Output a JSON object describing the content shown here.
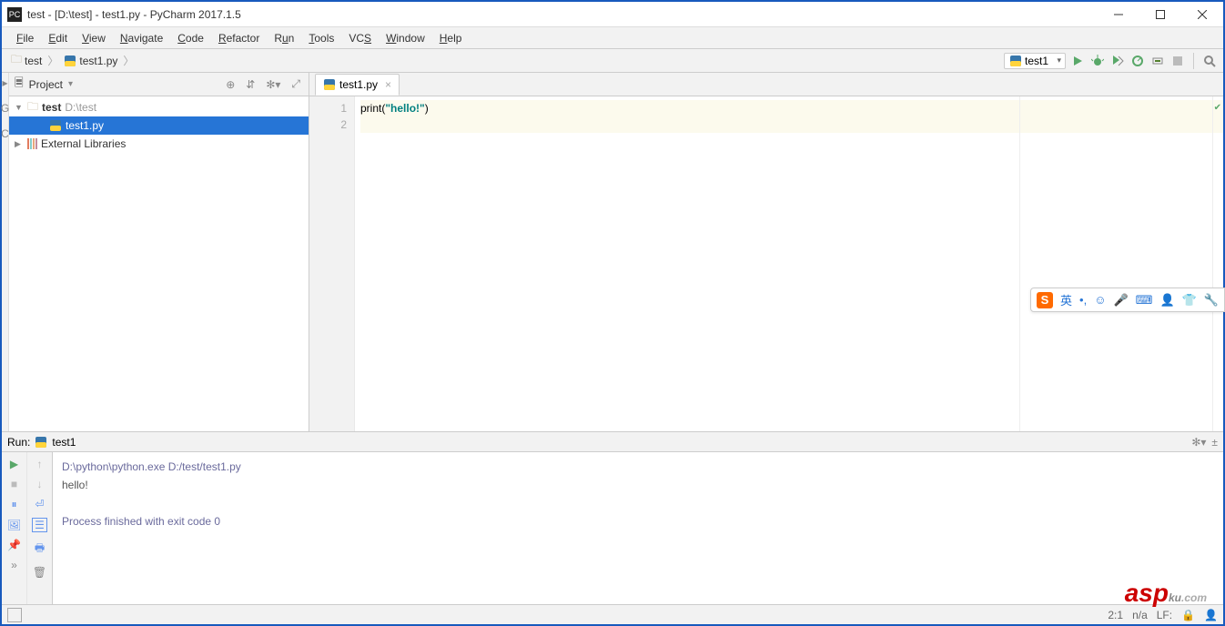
{
  "titlebar": {
    "app_icon_text": "PC",
    "title": "test - [D:\\test] - test1.py - PyCharm 2017.1.5"
  },
  "menu": {
    "items": [
      "File",
      "Edit",
      "View",
      "Navigate",
      "Code",
      "Refactor",
      "Run",
      "Tools",
      "VCS",
      "Window",
      "Help"
    ]
  },
  "breadcrumb": {
    "items": [
      "test",
      "test1.py"
    ]
  },
  "run_config": {
    "name": "test1"
  },
  "project": {
    "title": "Project",
    "root": {
      "name": "test",
      "path": "D:\\test"
    },
    "file": "test1.py",
    "ext_libs": "External Libraries"
  },
  "editor": {
    "tab": "test1.py",
    "lines": [
      "1",
      "2"
    ],
    "code": {
      "call": "print",
      "open": "(",
      "q1": "\"",
      "str": "hello!",
      "q2": "\"",
      "close": ")"
    }
  },
  "run_panel": {
    "label": "Run:",
    "name": "test1",
    "cmd": "D:\\python\\python.exe D:/test/test1.py",
    "out": "hello!",
    "exit": "Process finished with exit code 0"
  },
  "status": {
    "pos": "2:1",
    "enc": "n/a",
    "le": "LF:"
  },
  "ime": {
    "lang": "英"
  }
}
